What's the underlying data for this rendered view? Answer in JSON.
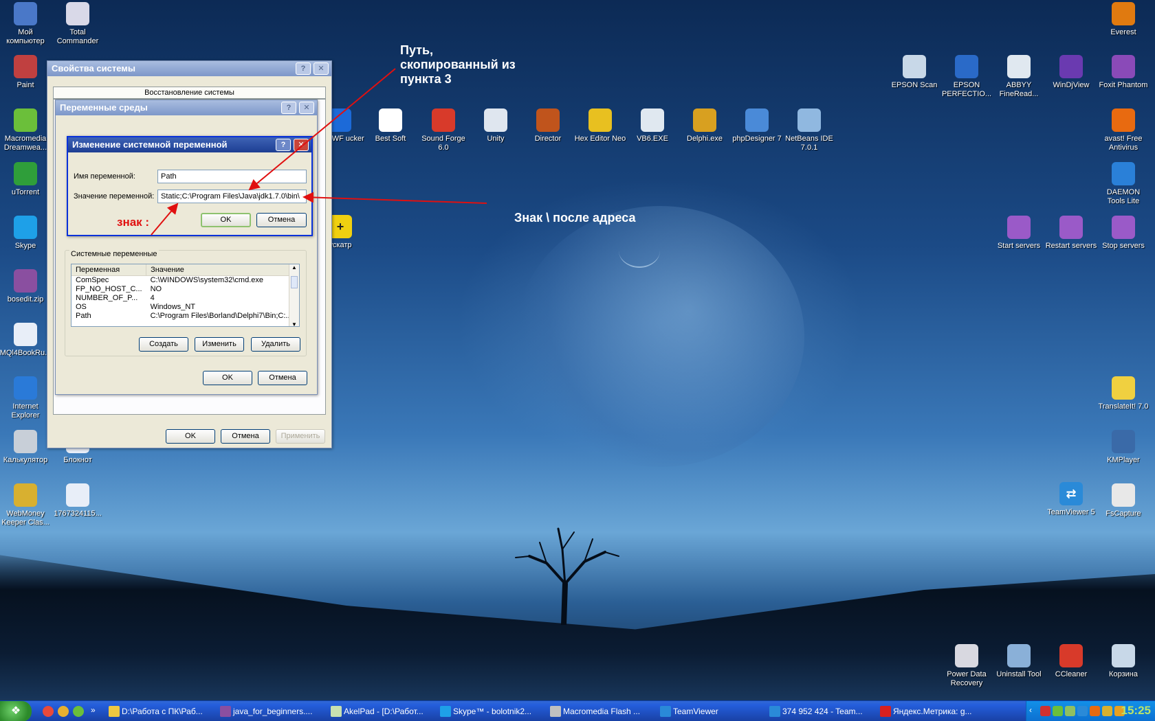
{
  "desktop": {
    "icons_left": [
      {
        "label": "Мой компьютер",
        "icon": "my-computer-icon",
        "color": "#4a78c8"
      },
      {
        "label": "Total Commander",
        "icon": "total-commander-icon",
        "color": "#d9d9e8"
      },
      {
        "label": "Paint",
        "icon": "paint-icon",
        "color": "#c04040"
      },
      {
        "label": "Macromedia Dreamwea...",
        "icon": "dreamweaver-icon",
        "color": "#6bbf3a"
      },
      {
        "label": "uTorrent",
        "icon": "utorrent-icon",
        "color": "#2f9e3a"
      },
      {
        "label": "Skype",
        "icon": "skype-icon",
        "color": "#1ea0e8"
      },
      {
        "label": "bosedit.zip",
        "icon": "winrar-icon",
        "color": "#8a4fa0"
      },
      {
        "label": "MQl4BookRu...",
        "icon": "help-file-icon",
        "color": "#e8eef8"
      },
      {
        "label": "Internet Explorer",
        "icon": "internet-explorer-icon",
        "color": "#2a7ad8"
      },
      {
        "label": "Калькулятор",
        "icon": "calculator-icon",
        "color": "#c8cfd8"
      },
      {
        "label": "Блокнот",
        "icon": "notepad-icon",
        "color": "#e8eef8"
      },
      {
        "label": "WebMoney Keeper Clas...",
        "icon": "webmoney-icon",
        "color": "#d8b030"
      },
      {
        "label": "1767324115...",
        "icon": "document-icon",
        "color": "#e8eef8"
      }
    ],
    "icons_row": [
      {
        "label": "ink SWF ucker",
        "icon": "swf-icon",
        "color": "#1c6ad8"
      },
      {
        "label": "Best Soft",
        "icon": "best-soft-icon",
        "color": "#ffffff"
      },
      {
        "label": "Sound Forge 6.0",
        "icon": "sound-forge-icon",
        "color": "#d83a2a"
      },
      {
        "label": "Unity",
        "icon": "unity-icon",
        "color": "#dfe6ef"
      },
      {
        "label": "Director",
        "icon": "director-icon",
        "color": "#c0541c"
      },
      {
        "label": "Hex Editor Neo",
        "icon": "hex-editor-icon",
        "color": "#e8c020"
      },
      {
        "label": "VB6.EXE",
        "icon": "vb6-icon",
        "color": "#e0e8f0"
      },
      {
        "label": "Delphi.exe",
        "icon": "delphi-icon",
        "color": "#d8a020"
      },
      {
        "label": "phpDesigner 7",
        "icon": "phpdesigner-icon",
        "color": "#4a8ad8"
      },
      {
        "label": "NetBeans IDE 7.0.1",
        "icon": "netbeans-icon",
        "color": "#90b8e0"
      }
    ],
    "icon_puntoswitcher": {
      "label": "ускатр",
      "icon": "puntoswitcher-icon",
      "color": "#f0d010"
    },
    "icons_right_top": [
      {
        "label": "EPSON Scan",
        "icon": "epson-scan-icon",
        "color": "#c8d8e8"
      },
      {
        "label": "EPSON PERFECTIO...",
        "icon": "epson-perfection-icon",
        "color": "#2a6ac8"
      },
      {
        "label": "ABBYY FineRead...",
        "icon": "abbyy-icon",
        "color": "#e0e8f0"
      },
      {
        "label": "WinDjView",
        "icon": "windjview-icon",
        "color": "#6a3ab0"
      },
      {
        "label": "Foxit Phantom",
        "icon": "foxit-icon",
        "color": "#8a4ab8"
      }
    ],
    "icons_right_col": [
      {
        "label": "Everest",
        "icon": "everest-icon",
        "color": "#e07a10"
      },
      {
        "label": "avast! Free Antivirus",
        "icon": "avast-icon",
        "color": "#e86a10"
      },
      {
        "label": "DAEMON Tools Lite",
        "icon": "daemon-tools-icon",
        "color": "#2a80d8"
      },
      {
        "label": "TranslateIt! 7.0",
        "icon": "translateit-icon",
        "color": "#f0d040"
      },
      {
        "label": "KMPlayer",
        "icon": "kmplayer-icon",
        "color": "#3a6aa8"
      },
      {
        "label": "FsCapture",
        "icon": "fscapture-icon",
        "color": "#e8e8e8"
      },
      {
        "label": "Корзина",
        "icon": "recycle-bin-icon",
        "color": "#c8d8e8"
      }
    ],
    "icons_servers": [
      {
        "label": "Start servers",
        "icon": "start-servers-icon",
        "color": "#9a5ac8"
      },
      {
        "label": "Restart servers",
        "icon": "restart-servers-icon",
        "color": "#9a5ac8"
      },
      {
        "label": "Stop servers",
        "icon": "stop-servers-icon",
        "color": "#9a5ac8"
      }
    ],
    "icon_teamviewer": {
      "label": "TeamViewer 5",
      "icon": "teamviewer-icon",
      "color": "#2a8ad8"
    },
    "icons_bottom_right": [
      {
        "label": "Power Data Recovery",
        "icon": "power-data-recovery-icon",
        "color": "#d8d8e0"
      },
      {
        "label": "Uninstall Tool",
        "icon": "uninstall-tool-icon",
        "color": "#8ab0d8"
      },
      {
        "label": "CCleaner",
        "icon": "ccleaner-icon",
        "color": "#d83a2a"
      }
    ]
  },
  "system_properties": {
    "title": "Свойства системы",
    "tab": "Восстановление системы",
    "ok": "OK",
    "cancel": "Отмена",
    "apply": "Применить"
  },
  "env_vars": {
    "title": "Переменные среды",
    "system_vars_label": "Системные переменные",
    "col_variable": "Переменная",
    "col_value": "Значение",
    "rows": [
      {
        "name": "ComSpec",
        "value": "C:\\WINDOWS\\system32\\cmd.exe"
      },
      {
        "name": "FP_NO_HOST_C...",
        "value": "NO"
      },
      {
        "name": "NUMBER_OF_P...",
        "value": "4"
      },
      {
        "name": "OS",
        "value": "Windows_NT"
      },
      {
        "name": "Path",
        "value": "C:\\Program Files\\Borland\\Delphi7\\Bin;C:..."
      }
    ],
    "create": "Создать",
    "edit": "Изменить",
    "delete": "Удалить",
    "ok": "OK",
    "cancel": "Отмена"
  },
  "edit_var": {
    "title": "Изменение системной переменной",
    "name_label": "Имя переменной:",
    "name_value": "Path",
    "value_label": "Значение переменной:",
    "value_value": "Static;C:\\Program Files\\Java\\jdk1.7.0\\bin\\",
    "ok": "OK",
    "cancel": "Отмена"
  },
  "annotations": {
    "path_note": [
      "Путь,",
      "скопированный из",
      "пункта 3"
    ],
    "backslash_note": "Знак \\ после адреса",
    "semicolon_note": "знак :"
  },
  "taskbar": {
    "start": "",
    "tasks": [
      {
        "label": "D:\\Работа с ПК\\Раб...",
        "icon": "folder-icon",
        "color": "#f0c840"
      },
      {
        "label": "java_for_beginners....",
        "icon": "winrar-icon",
        "color": "#8a4fa0"
      },
      {
        "label": "AkelPad - [D:\\Работ...",
        "icon": "akelpad-icon",
        "color": "#c8e0b0"
      },
      {
        "label": "Skype™ - bolotnik2...",
        "icon": "skype-icon",
        "color": "#1ea0e8"
      },
      {
        "label": "Macromedia Flash ...",
        "icon": "flash-icon",
        "color": "#c0c0c0"
      },
      {
        "label": "TeamViewer",
        "icon": "teamviewer-icon",
        "color": "#2a8ad8"
      },
      {
        "label": "374 952 424 - Team...",
        "icon": "teamviewer-icon",
        "color": "#2a8ad8"
      },
      {
        "label": "Яндекс.Метрика: g...",
        "icon": "opera-icon",
        "color": "#d82020"
      }
    ],
    "clock": "15:25"
  }
}
